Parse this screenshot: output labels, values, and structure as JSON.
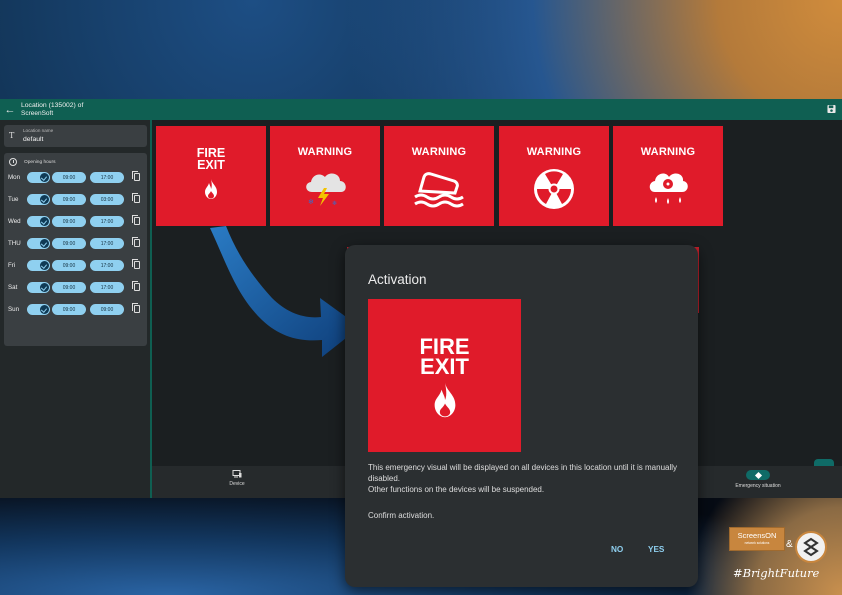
{
  "app": {
    "title_line1": "Location (135002) of",
    "title_line2": "ScreenSoft",
    "location_label": "Location name",
    "location_value": "default",
    "opening_hours_title": "Opening hours"
  },
  "schedule": [
    {
      "day": "Mon",
      "open": "09:00",
      "close": "17:00",
      "enabled": true
    },
    {
      "day": "Tue",
      "open": "09:00",
      "close": "03:00",
      "enabled": true
    },
    {
      "day": "Wed",
      "open": "09:00",
      "close": "17:00",
      "enabled": true
    },
    {
      "day": "THU",
      "open": "09:00",
      "close": "17:00",
      "enabled": true
    },
    {
      "day": "Fri",
      "open": "09:00",
      "close": "17:00",
      "enabled": true
    },
    {
      "day": "Sat",
      "open": "09:00",
      "close": "17:00",
      "enabled": true
    },
    {
      "day": "Sun",
      "open": "09:00",
      "close": "09:00",
      "enabled": true
    }
  ],
  "tiles": {
    "fire_line1": "FIRE",
    "fire_line2": "EXIT",
    "warning": "WARNING"
  },
  "bottom_nav": {
    "device": "Device",
    "emergency": "Emergency situation"
  },
  "dialog": {
    "title": "Activation",
    "visual_line1": "FIRE",
    "visual_line2": "EXIT",
    "body1": "This emergency visual will be displayed on all devices in this location until it is manually disabled.",
    "body2": "Other functions on the devices will be suspended.",
    "confirm": "Confirm activation.",
    "no": "NO",
    "yes": "YES"
  },
  "branding": {
    "brand": "ScreensON",
    "brand_sub": "network solutions",
    "amp": "&",
    "hashtag": "#BrightFuture"
  },
  "colors": {
    "emergency_red": "#e01b2a",
    "topbar_green": "#0f5f52",
    "accent_blue": "#8fd0f0"
  }
}
